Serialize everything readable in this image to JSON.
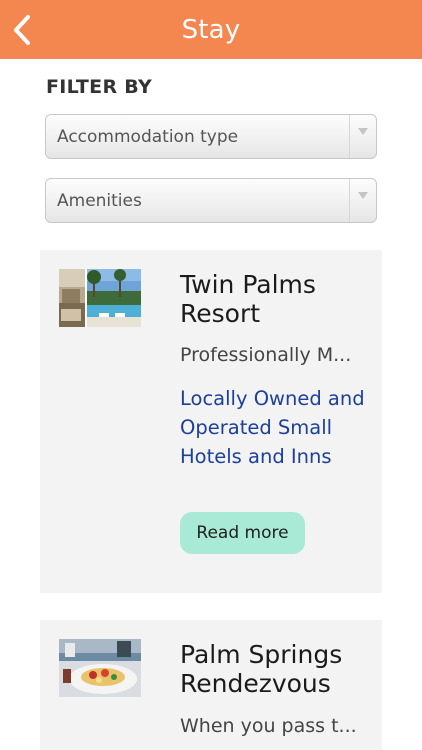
{
  "header": {
    "title": "Stay",
    "back_icon": "chevron-left-icon",
    "background": "#f4874f"
  },
  "filters": {
    "label": "FILTER BY",
    "selects": [
      {
        "value": "Accommodation type"
      },
      {
        "value": "Amenities"
      }
    ]
  },
  "listings": [
    {
      "title": "Twin Palms Resort",
      "description": "Professionally M...",
      "category": "Locally Owned and Operated Small Hotels and Inns",
      "read_more": "Read more"
    },
    {
      "title": "Palm Springs Rendezvous",
      "description": "When you pass t..."
    }
  ],
  "colors": {
    "accent": "#f4874f",
    "link": "#1c3f99",
    "button": "#a8ead5",
    "card_bg": "#f3f3f3"
  }
}
